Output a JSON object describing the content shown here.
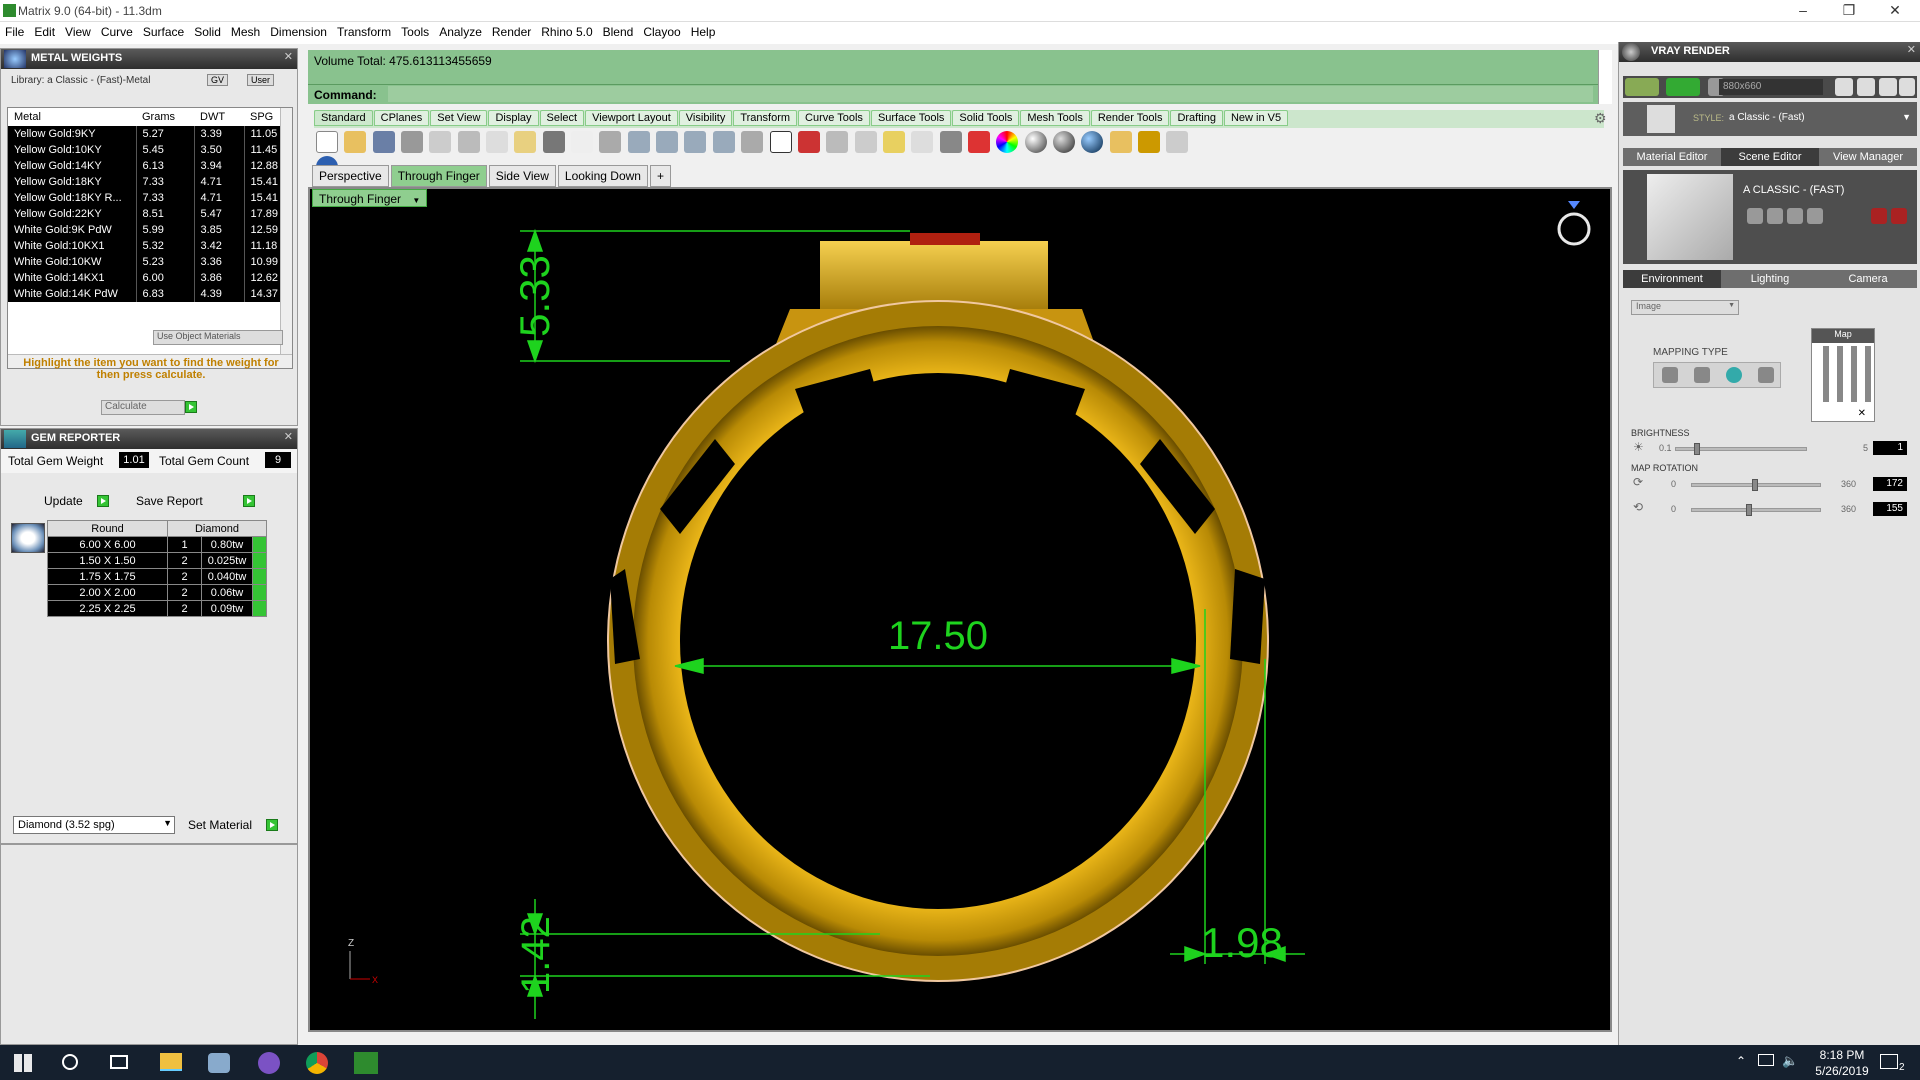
{
  "window": {
    "title": "Matrix 9.0 (64-bit) - 11.3dm",
    "controls": [
      "–",
      "❐",
      "✕"
    ]
  },
  "menu": [
    "File",
    "Edit",
    "View",
    "Curve",
    "Surface",
    "Solid",
    "Mesh",
    "Dimension",
    "Transform",
    "Tools",
    "Analyze",
    "Render",
    "Rhino 5.0",
    "Blend",
    "Clayoo",
    "Help"
  ],
  "metal_weights": {
    "title": "METAL WEIGHTS",
    "library": "Library: a Classic - (Fast)-Metal",
    "gv": "GV",
    "user": "User",
    "headers": [
      "Metal",
      "Grams",
      "DWT",
      "SPG"
    ],
    "rows": [
      [
        "Yellow Gold:9KY",
        "5.27",
        "3.39",
        "11.05"
      ],
      [
        "Yellow Gold:10KY",
        "5.45",
        "3.50",
        "11.45"
      ],
      [
        "Yellow Gold:14KY",
        "6.13",
        "3.94",
        "12.88"
      ],
      [
        "Yellow Gold:18KY",
        "7.33",
        "4.71",
        "15.41"
      ],
      [
        "Yellow Gold:18KY R...",
        "7.33",
        "4.71",
        "15.41"
      ],
      [
        "Yellow Gold:22KY",
        "8.51",
        "5.47",
        "17.89"
      ],
      [
        "White Gold:9K PdW",
        "5.99",
        "3.85",
        "12.59"
      ],
      [
        "White Gold:10KX1",
        "5.32",
        "3.42",
        "11.18"
      ],
      [
        "White Gold:10KW",
        "5.23",
        "3.36",
        "10.99"
      ],
      [
        "White Gold:14KX1",
        "6.00",
        "3.86",
        "12.62"
      ],
      [
        "White Gold:14K PdW",
        "6.83",
        "4.39",
        "14.37"
      ]
    ],
    "use_object_materials": "Use Object Materials",
    "hint": "Highlight the item you want to find the weight for then press calculate.",
    "calculate": "Calculate"
  },
  "gem_reporter": {
    "title": "GEM REPORTER",
    "total_weight_label": "Total Gem Weight",
    "total_weight": "1.01",
    "total_count_label": "Total Gem Count",
    "total_count": "9",
    "update": "Update",
    "save_report": "Save Report",
    "headers": [
      "Round",
      "Diamond"
    ],
    "rows": [
      [
        "6.00 X 6.00",
        "1",
        "0.80tw"
      ],
      [
        "1.50 X 1.50",
        "2",
        "0.025tw"
      ],
      [
        "1.75 X 1.75",
        "2",
        "0.040tw"
      ],
      [
        "2.00 X 2.00",
        "2",
        "0.06tw"
      ],
      [
        "2.25 X 2.25",
        "2",
        "0.09tw"
      ]
    ],
    "material_select": "Diamond    (3.52 spg)",
    "set_material": "Set Material"
  },
  "command": {
    "volume": "Volume Total: 475.613113455659",
    "label": "Command:"
  },
  "toolbar_tabs": [
    "Standard",
    "CPlanes",
    "Set View",
    "Display",
    "Select",
    "Viewport Layout",
    "Visibility",
    "Transform",
    "Curve Tools",
    "Surface Tools",
    "Solid Tools",
    "Mesh Tools",
    "Render Tools",
    "Drafting",
    "New in V5"
  ],
  "view_tabs": [
    "Perspective",
    "Through Finger",
    "Side View",
    "Looking Down",
    "+"
  ],
  "viewport": {
    "name": "Through Finger",
    "dims": {
      "height": "5.33",
      "inner": "17.50",
      "bottom": "1.42",
      "side": "1.98"
    },
    "axis_z": "Z",
    "axis_x": "X"
  },
  "vray": {
    "title": "VRAY RENDER",
    "resolution": "880x660",
    "style_label": "STYLE:",
    "style": "a Classic - (Fast)",
    "tabs": [
      "Material Editor",
      "Scene Editor",
      "View Manager"
    ],
    "scene_name": "A CLASSIC - (FAST)",
    "env_tabs": [
      "Environment",
      "Lighting",
      "Camera"
    ],
    "image_select": "Image",
    "mapping_type": "MAPPING TYPE",
    "map_label": "Map",
    "brightness_label": "BRIGHTNESS",
    "brightness_min": "0.1",
    "brightness_max": "5",
    "brightness_value": "1",
    "rotation_label": "MAP ROTATION",
    "rot_min": "0",
    "rot_max": "360",
    "rot1": "172",
    "rot2": "155"
  },
  "taskbar": {
    "time": "8:18 PM",
    "date": "5/26/2019",
    "notif": "2"
  }
}
